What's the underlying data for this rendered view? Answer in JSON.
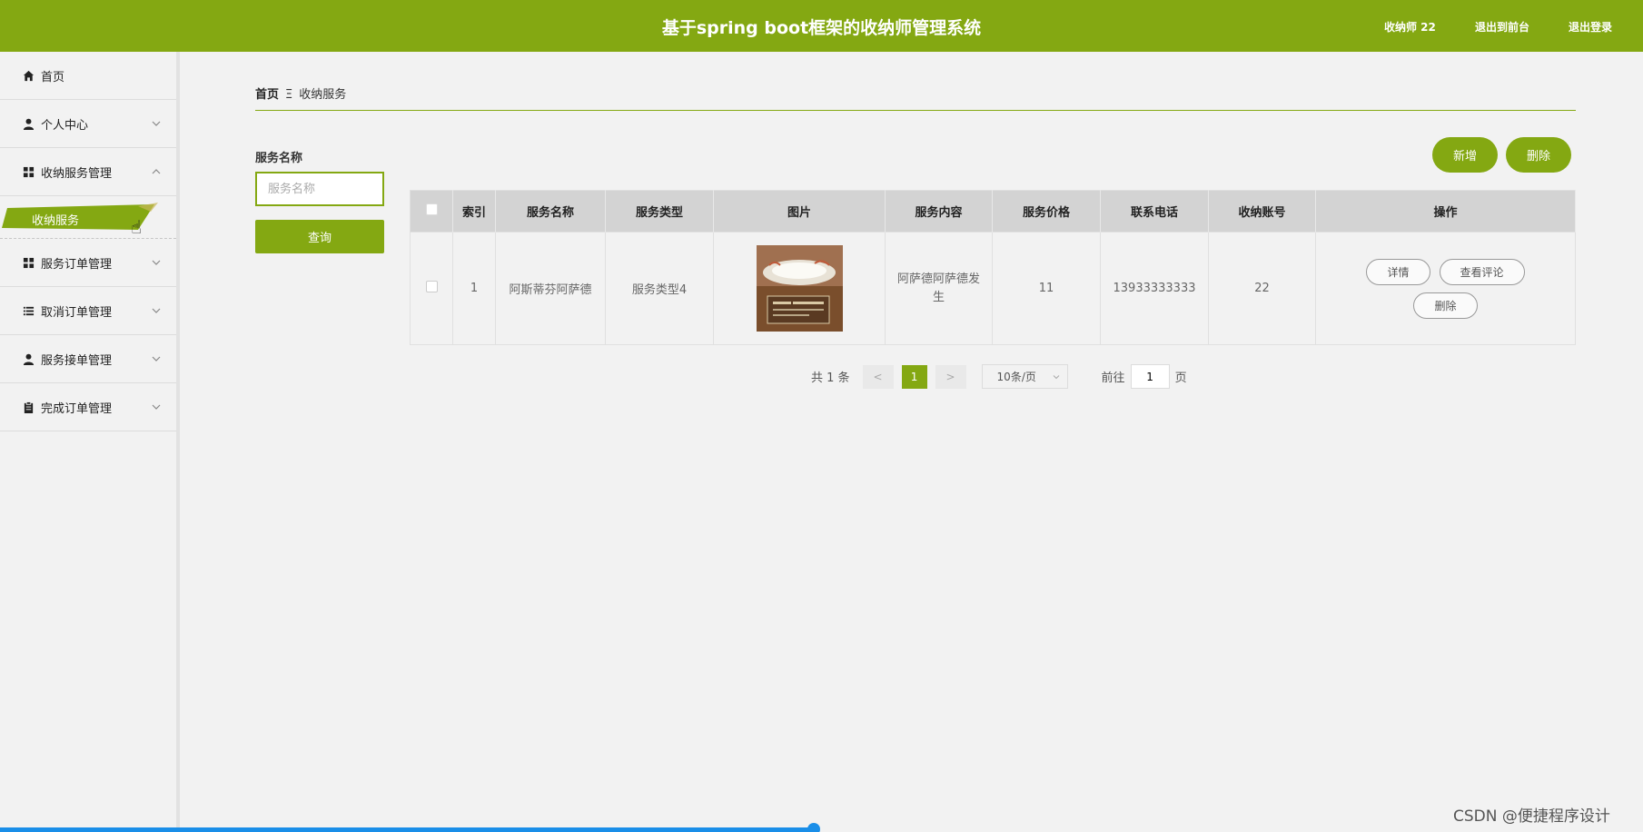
{
  "header": {
    "title": "基于spring boot框架的收纳师管理系统",
    "user": "收纳师 22",
    "back": "退出到前台",
    "logout": "退出登录",
    "accent": "#84a812"
  },
  "sidebar": {
    "items": [
      {
        "label": "首页",
        "icon": "home-icon"
      },
      {
        "label": "个人中心",
        "icon": "person-icon"
      },
      {
        "label": "收纳服务管理",
        "icon": "grid-icon"
      },
      {
        "label": "服务订单管理",
        "icon": "grid-icon"
      },
      {
        "label": "取消订单管理",
        "icon": "list-icon"
      },
      {
        "label": "服务接单管理",
        "icon": "person-icon"
      },
      {
        "label": "完成订单管理",
        "icon": "clipboard-icon"
      }
    ],
    "sub_item": "收纳服务"
  },
  "breadcrumb": {
    "home": "首页",
    "separator": "Ξ",
    "current": "收纳服务"
  },
  "search": {
    "label": "服务名称",
    "placeholder": "服务名称",
    "button": "查询"
  },
  "actions": {
    "add": "新增",
    "delete": "删除"
  },
  "table": {
    "headers": [
      "索引",
      "服务名称",
      "服务类型",
      "图片",
      "服务内容",
      "服务价格",
      "联系电话",
      "收纳账号",
      "操作"
    ],
    "rows": [
      {
        "index": "1",
        "name": "阿斯蒂芬阿萨德",
        "type": "服务类型4",
        "content": "阿萨德阿萨德发生",
        "price": "11",
        "phone": "13933333333",
        "account": "22",
        "ops": [
          "详情",
          "查看评论",
          "删除"
        ]
      }
    ]
  },
  "pagination": {
    "total": "共 1 条",
    "prev": "<",
    "current": "1",
    "next": ">",
    "page_size": "10条/页",
    "goto_label": "前往",
    "goto_value": "1",
    "page_suffix": "页"
  },
  "watermark": "CSDN @便捷程序设计"
}
